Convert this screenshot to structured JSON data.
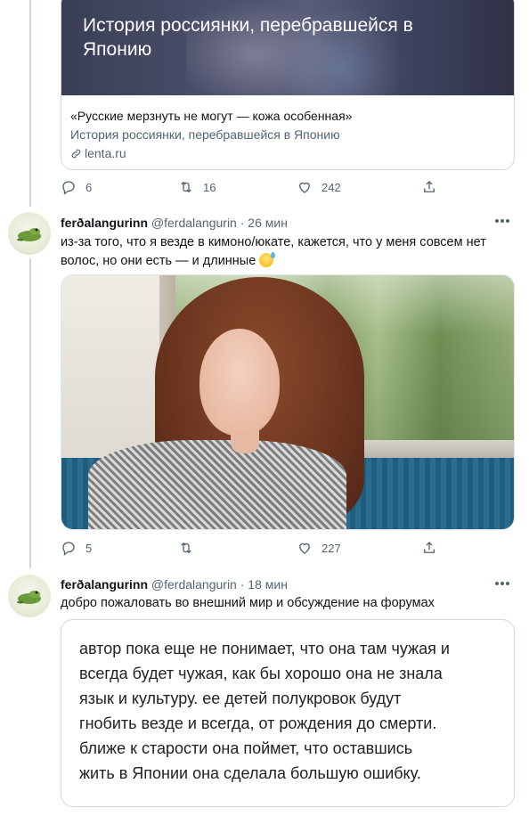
{
  "link_card": {
    "overlay_title": "История россиянки, перебравшейся в Японию",
    "quote": "«Русские мерзнуть не могут — кожа особенная»",
    "subtitle": "История россиянки, перебравшейся в Японию",
    "domain": "lenta.ru"
  },
  "tweet_prev": {
    "replies": "6",
    "retweets": "16",
    "likes": "242"
  },
  "tweet1": {
    "name": "ferðalangurinn",
    "handle": "@ferdalangurin",
    "time": "· 26 мин",
    "text": "из-за того, что я везде в кимоно/юкате, кажется, что у меня совсем нет волос, но они есть — и длинные",
    "emoji_icon": "sweat-smile-emoji",
    "replies": "5",
    "retweets": "",
    "likes": "227"
  },
  "tweet2": {
    "name": "ferðalangurinn",
    "handle": "@ferdalangurin",
    "time": "· 18 мин",
    "text": "добро пожаловать во внешний мир и обсуждение на форумах",
    "quote_lines": [
      "автор пока еще не понимает, что она там чужая и",
      "всегда будет чужая, как бы хорошо она не знала",
      "язык и культуру. ее детей полукровок будут",
      "гнобить везде и всегда, от рождения до смерти.",
      "ближе к старости она поймет, что оставшись",
      "жить в Японии она сделала большую ошибку."
    ]
  }
}
